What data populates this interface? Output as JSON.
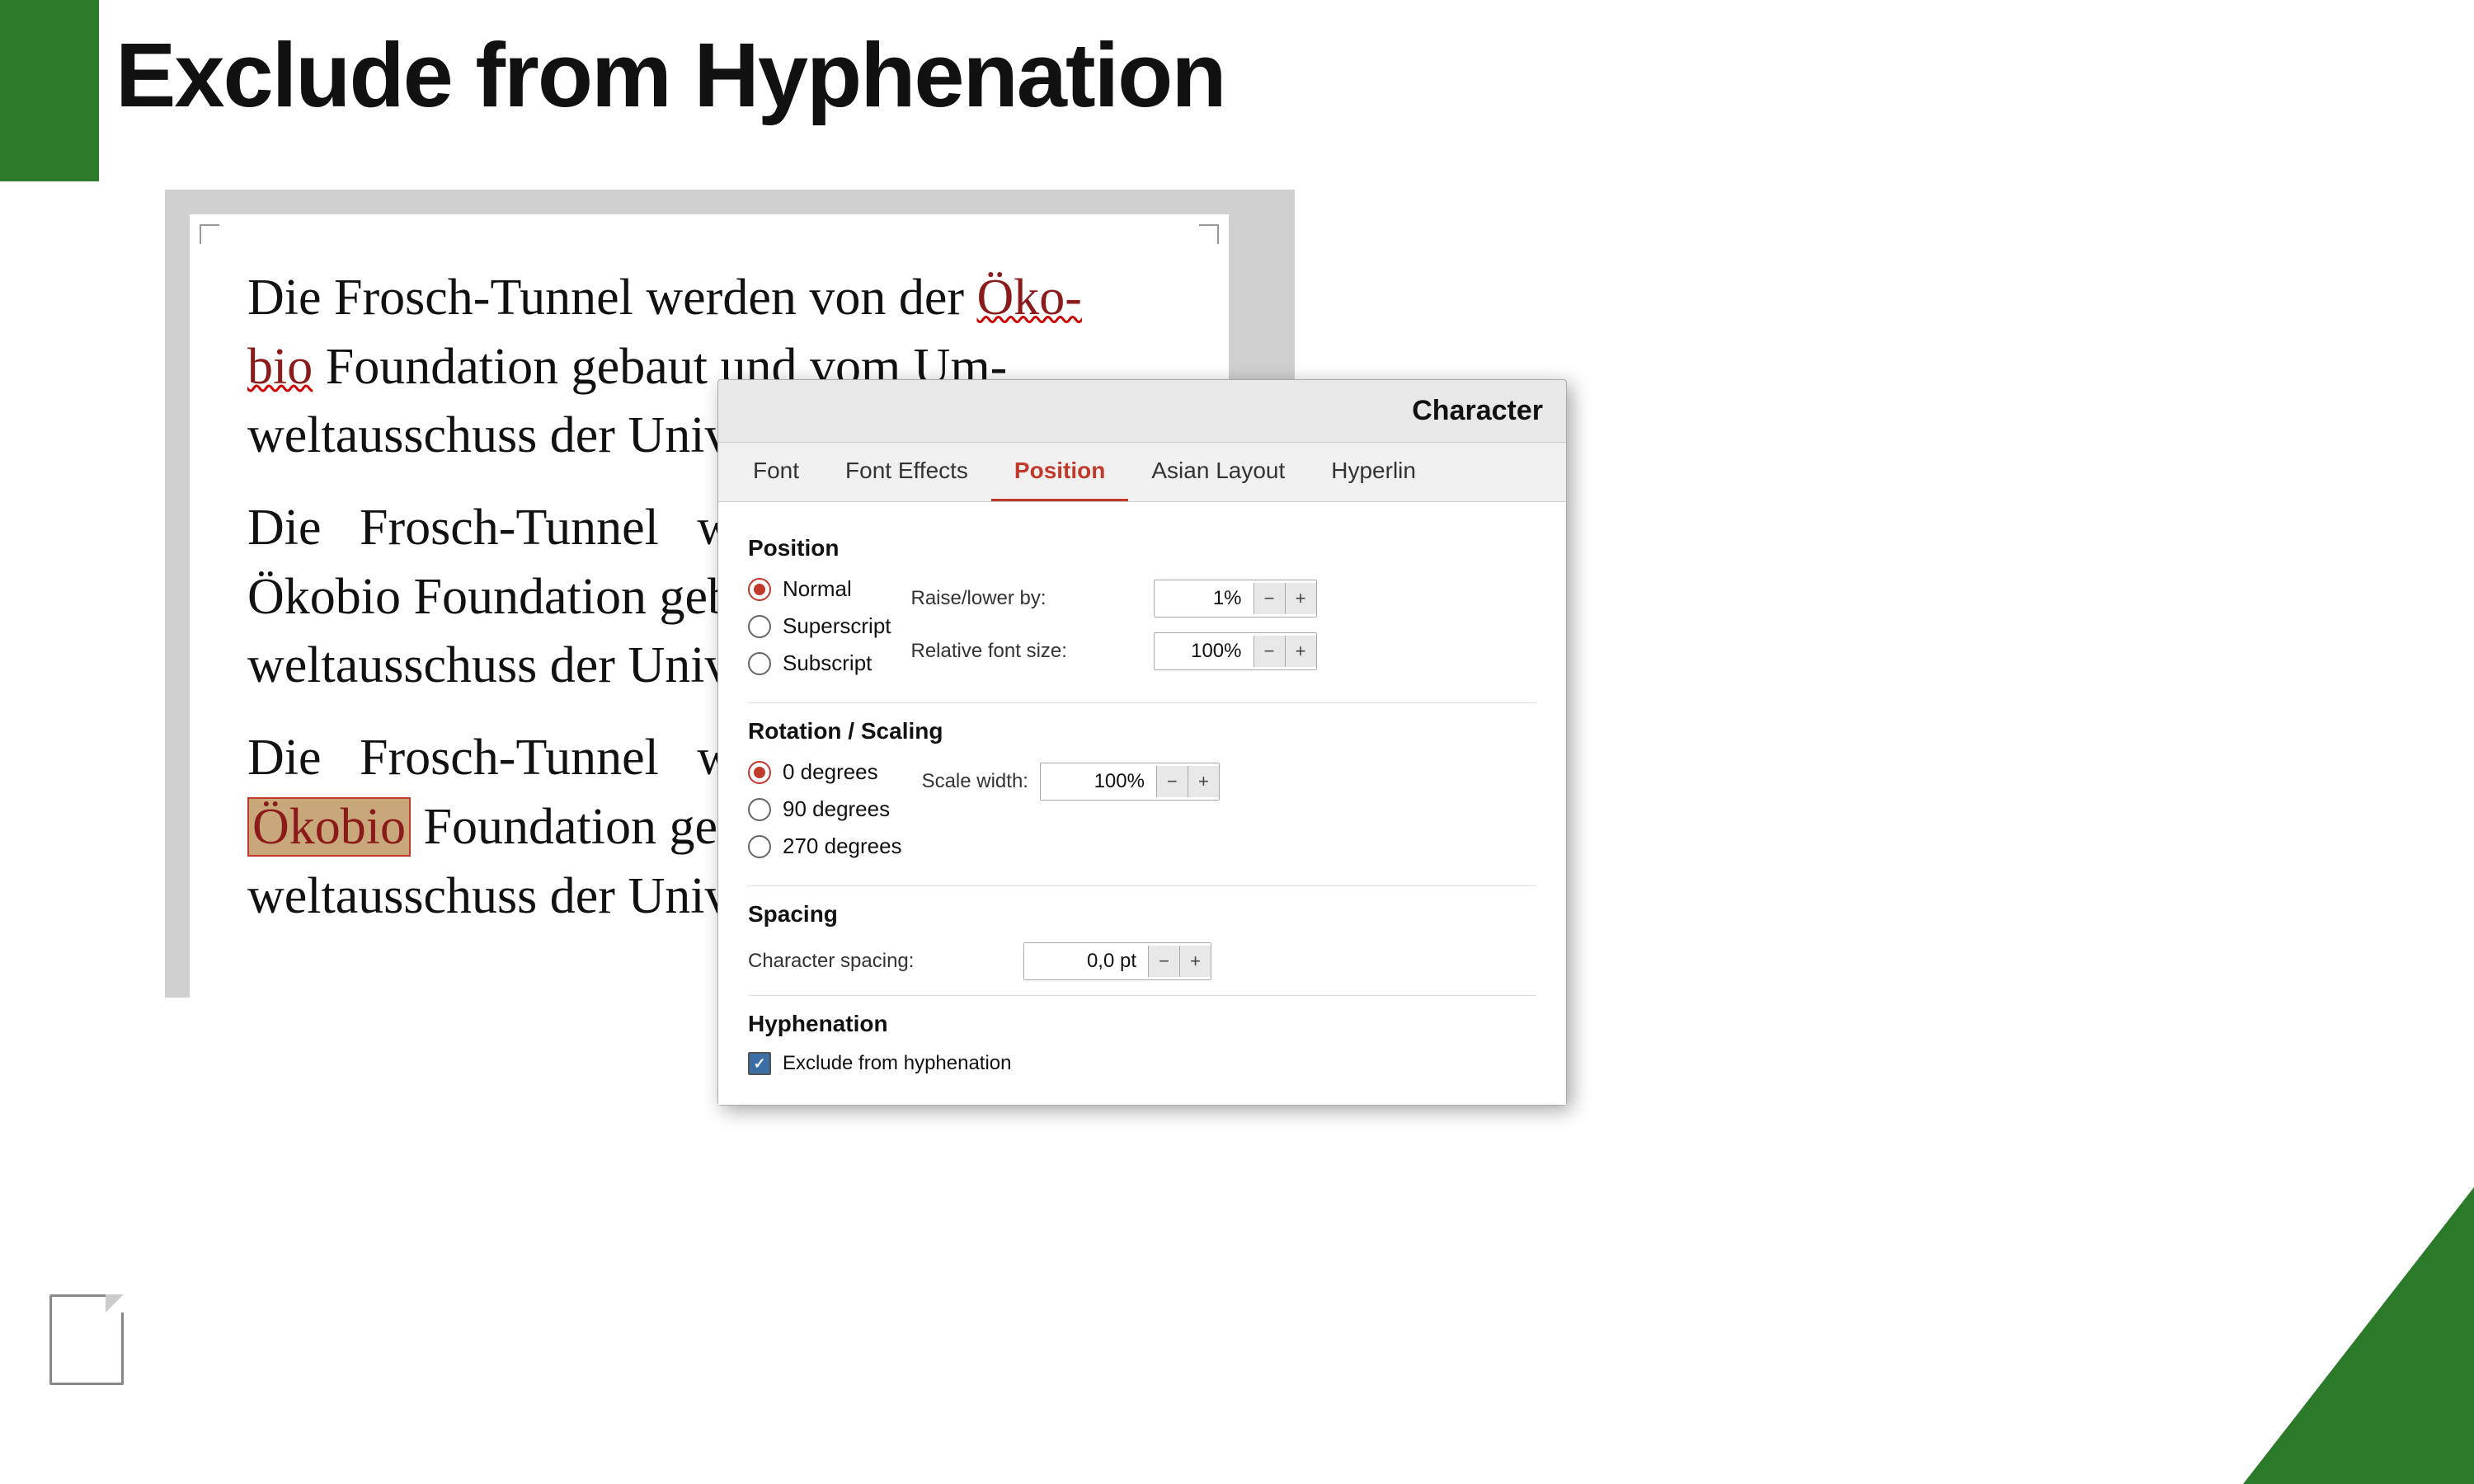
{
  "page": {
    "title": "Exclude from Hyphenation",
    "background_color": "#ffffff"
  },
  "document": {
    "paragraphs": [
      "Die Frosch-Tunnel werden von der Öko-bio Foundation gebaut und vom Umweltausschuss der Unive",
      "Die Frosch-Tunnel w Ökobio Foundation geba weltausschuss der Unive",
      "Die Frosch-Tunnel w"
    ]
  },
  "dialog": {
    "title": "Character",
    "tabs": [
      {
        "id": "font",
        "label": "Font",
        "active": false
      },
      {
        "id": "font-effects",
        "label": "Font Effects",
        "active": false
      },
      {
        "id": "position",
        "label": "Position",
        "active": true
      },
      {
        "id": "asian-layout",
        "label": "Asian Layout",
        "active": false
      },
      {
        "id": "hyperlink",
        "label": "Hyperlin",
        "active": false
      }
    ],
    "position_section": {
      "heading": "Position",
      "radio_options": [
        {
          "id": "normal",
          "label": "Normal",
          "selected": true
        },
        {
          "id": "superscript",
          "label": "Superscript",
          "selected": false
        },
        {
          "id": "subscript",
          "label": "Subscript",
          "selected": false
        }
      ],
      "raise_lower_label": "Raise/lower by:",
      "raise_lower_value": "1%",
      "relative_font_label": "Relative font size:",
      "relative_font_value": "100%"
    },
    "rotation_section": {
      "heading": "Rotation / Scaling",
      "radio_options": [
        {
          "id": "0deg",
          "label": "0 degrees",
          "selected": true
        },
        {
          "id": "90deg",
          "label": "90 degrees",
          "selected": false
        },
        {
          "id": "270deg",
          "label": "270 degrees",
          "selected": false
        }
      ],
      "scale_label": "Scale width:",
      "scale_value": "100%"
    },
    "spacing_section": {
      "heading": "Spacing",
      "character_spacing_label": "Character spacing:",
      "character_spacing_value": "0,0 pt"
    },
    "hyphenation_section": {
      "heading": "Hyphenation",
      "checkbox_label": "Exclude from hyphenation",
      "checked": true
    }
  },
  "icons": {
    "minus": "−",
    "plus": "+",
    "checkmark": "✓"
  }
}
